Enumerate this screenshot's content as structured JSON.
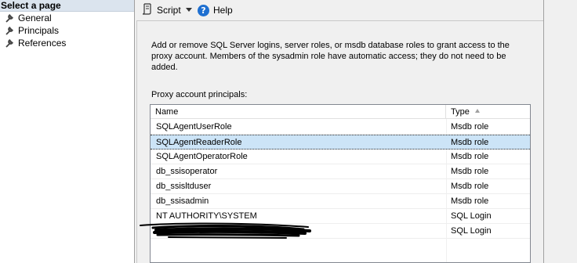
{
  "nav": {
    "header": "Select a page",
    "items": [
      {
        "label": "General"
      },
      {
        "label": "Principals"
      },
      {
        "label": "References"
      }
    ]
  },
  "toolbar": {
    "script_label": "Script",
    "help_label": "Help",
    "help_glyph": "?"
  },
  "main": {
    "description": "Add or remove SQL Server logins, server roles, or msdb database roles to grant access to the proxy account. Members of the sysadmin role have automatic access; they do not need to be added.",
    "list_caption": "Proxy account principals:",
    "columns": {
      "name": "Name",
      "type": "Type"
    },
    "rows": [
      {
        "name": "SQLAgentUserRole",
        "type": "Msdb role",
        "selected": false
      },
      {
        "name": "SQLAgentReaderRole",
        "type": "Msdb role",
        "selected": true
      },
      {
        "name": "SQLAgentOperatorRole",
        "type": "Msdb role",
        "selected": false
      },
      {
        "name": "db_ssisoperator",
        "type": "Msdb role",
        "selected": false
      },
      {
        "name": "db_ssisltduser",
        "type": "Msdb role",
        "selected": false
      },
      {
        "name": "db_ssisadmin",
        "type": "Msdb role",
        "selected": false
      },
      {
        "name": "NT AUTHORITY\\SYSTEM",
        "type": "SQL Login",
        "selected": false
      },
      {
        "name": "",
        "type": "SQL Login",
        "selected": false
      }
    ]
  },
  "colors": {
    "selected_row": "#cce4f7",
    "nav_header_bg": "#dbe4ee",
    "help_icon": "#1e6fd0"
  }
}
